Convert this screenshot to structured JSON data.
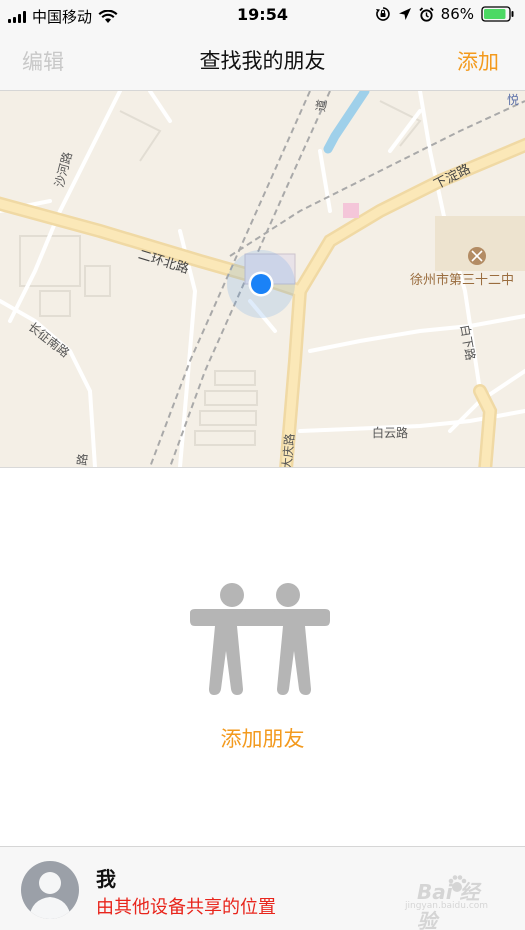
{
  "status_bar": {
    "carrier": "中国移动",
    "time": "19:54",
    "battery": "86%",
    "icons": [
      "signal-icon",
      "wifi-icon",
      "orientation-lock-icon",
      "location-arrow-icon",
      "alarm-icon",
      "battery-icon"
    ]
  },
  "nav": {
    "edit_label": "编辑",
    "title": "查找我的朋友",
    "add_label": "添加"
  },
  "map": {
    "labels": {
      "road_shahe": "沙河路",
      "road_erhuan": "二环北路",
      "road_changzheng": "长征南路",
      "road_xiadian": "下淀路",
      "poi_school": "徐州市第三十二中",
      "road_baixia": "白下路",
      "road_baiyun": "白云路",
      "road_daqing": "大庆路",
      "road_dao": "道",
      "road_yue": "悦",
      "road_lu": "路"
    }
  },
  "empty_state": {
    "icon": "friends-icon",
    "add_friend_label": "添加朋友"
  },
  "me": {
    "name": "我",
    "location_source": "由其他设备共享的位置"
  },
  "watermark": {
    "text": "Bai 经验",
    "sub": "jingyan.baidu.com"
  },
  "colors": {
    "accent": "#f39a1e",
    "location_dot": "#1a82f7",
    "warning_text": "#e8251c",
    "battery": "#4cd964"
  }
}
